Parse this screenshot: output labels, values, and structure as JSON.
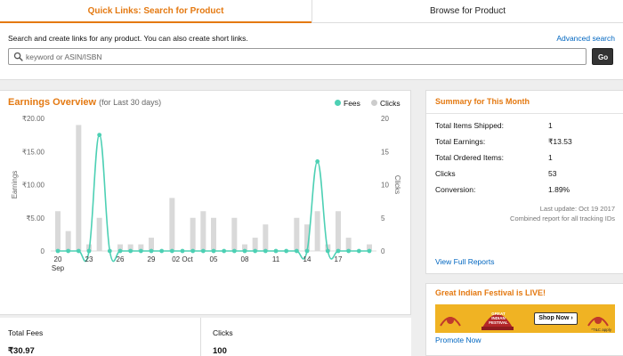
{
  "tabs": [
    {
      "label": "Quick Links: Search for Product",
      "active": true
    },
    {
      "label": "Browse for Product",
      "active": false
    }
  ],
  "search": {
    "description": "Search and create links for any product. You can also create short links.",
    "advanced_link": "Advanced search",
    "placeholder": "keyword or ASIN/ISBN",
    "value": "",
    "go_label": "Go"
  },
  "earnings": {
    "title": "Earnings Overview",
    "subtitle": "(for Last 30 days)",
    "legend": [
      {
        "label": "Fees",
        "color": "#4dd0b4"
      },
      {
        "label": "Clicks",
        "color": "#cccccc"
      }
    ]
  },
  "chart_data": {
    "type": "bar",
    "ylabel": "Earnings",
    "y2label": "Clicks",
    "ylim": [
      0,
      20
    ],
    "y2lim": [
      0,
      20
    ],
    "yticks": [
      "₹20.00",
      "₹15.00",
      "₹10.00",
      "₹5.00",
      "0"
    ],
    "y2ticks": [
      "20",
      "15",
      "10",
      "5",
      "0"
    ],
    "xtick_labels": [
      {
        "label": "20",
        "index": 0
      },
      {
        "label": "23",
        "index": 3
      },
      {
        "label": "26",
        "index": 6
      },
      {
        "label": "29",
        "index": 9
      },
      {
        "label": "02 Oct",
        "index": 12
      },
      {
        "label": "05",
        "index": 15
      },
      {
        "label": "08",
        "index": 18
      },
      {
        "label": "11",
        "index": 21
      },
      {
        "label": "14",
        "index": 24
      },
      {
        "label": "17",
        "index": 27
      }
    ],
    "month_label": "Sep",
    "series": [
      {
        "name": "Clicks",
        "kind": "bar",
        "color": "#d9d9d9",
        "values": [
          6,
          3,
          19,
          1,
          5,
          0,
          1,
          1,
          1,
          2,
          0,
          8,
          0,
          5,
          6,
          5,
          0,
          5,
          1,
          2,
          4,
          0,
          0,
          5,
          4,
          6,
          1,
          6,
          2,
          0,
          1
        ]
      },
      {
        "name": "Fees",
        "kind": "line",
        "color": "#4dd0b4",
        "values": [
          0,
          0,
          0,
          0,
          17.5,
          0,
          0,
          0,
          0,
          0,
          0,
          0,
          0,
          0,
          0,
          0,
          0,
          0,
          0,
          0,
          0,
          0,
          0,
          0,
          0,
          13.5,
          0,
          0,
          0,
          0,
          0
        ]
      }
    ]
  },
  "totals": {
    "fees_label": "Total Fees",
    "fees_value": "₹30.97",
    "clicks_label": "Clicks",
    "clicks_value": "100"
  },
  "summary": {
    "title": "Summary for This Month",
    "rows": [
      {
        "label": "Total Items Shipped:",
        "value": "1"
      },
      {
        "label": "Total Earnings:",
        "value": "₹13.53"
      },
      {
        "label": "Total Ordered Items:",
        "value": "1"
      },
      {
        "label": "Clicks",
        "value": "53"
      },
      {
        "label": "Conversion:",
        "value": "1.89%"
      }
    ],
    "last_update": "Last update: Oct 19 2017",
    "combined": "Combined report for all tracking IDs",
    "view_reports": "View Full Reports"
  },
  "promo": {
    "title": "Great Indian Festival is LIVE!",
    "banner_logo_text": "GREAT INDIAN FESTIVAL",
    "banner_button": "Shop Now",
    "banner_tc": "*T&C apply",
    "link": "Promote Now"
  },
  "colors": {
    "accent": "#e47911",
    "link": "#0066c0",
    "fees": "#4dd0b4",
    "clicks": "#d9d9d9",
    "banner": "#f0b323"
  }
}
